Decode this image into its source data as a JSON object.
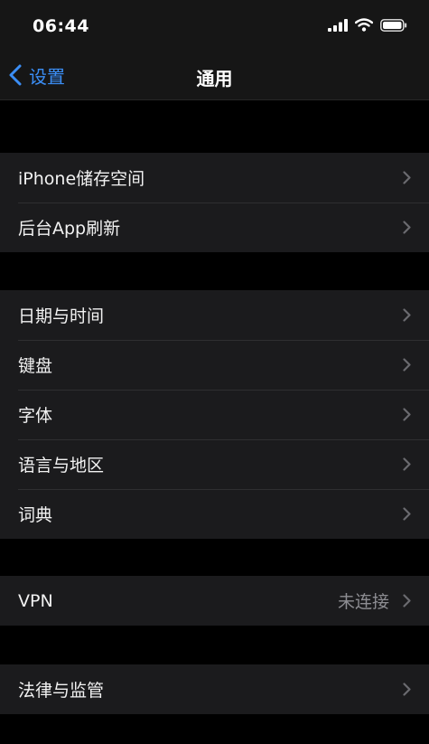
{
  "status_bar": {
    "time": "06:44",
    "icons": [
      "cellular-signal-icon",
      "wifi-icon",
      "battery-icon"
    ]
  },
  "nav": {
    "back_label": "设置",
    "title": "通用"
  },
  "groups": [
    {
      "items": [
        {
          "label": "iPhone储存空间"
        },
        {
          "label": "后台App刷新"
        }
      ]
    },
    {
      "items": [
        {
          "label": "日期与时间"
        },
        {
          "label": "键盘"
        },
        {
          "label": "字体"
        },
        {
          "label": "语言与地区"
        },
        {
          "label": "词典"
        }
      ]
    },
    {
      "items": [
        {
          "label": "VPN",
          "value": "未连接"
        }
      ]
    },
    {
      "items": [
        {
          "label": "法律与监管"
        }
      ]
    }
  ],
  "colors": {
    "accent": "#3b8ef5",
    "background": "#000000",
    "cell": "#1b1b1d",
    "secondary_text": "#8d8d92"
  }
}
